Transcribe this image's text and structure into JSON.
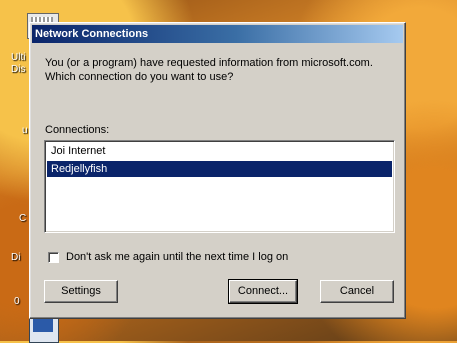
{
  "window": {
    "title": "Network Connections"
  },
  "message": "You (or a program) have requested information from microsoft.com. Which connection do you want to use?",
  "connections": {
    "label": "Connections:",
    "items": [
      {
        "label": "Joi Internet",
        "selected": false
      },
      {
        "label": "Redjellyfish",
        "selected": true
      }
    ]
  },
  "checkbox": {
    "label": "Don't ask me again until the next time I log on",
    "checked": false
  },
  "buttons": {
    "settings": "Settings",
    "connect": "Connect...",
    "cancel": "Cancel"
  },
  "desktop": {
    "texts": [
      "Ulti",
      "Dis",
      "u",
      "C",
      "Di",
      "0"
    ]
  },
  "colors": {
    "title_bar": "#0a246a",
    "selection": "#0a246a",
    "dialog_face": "#d4d0c8"
  }
}
